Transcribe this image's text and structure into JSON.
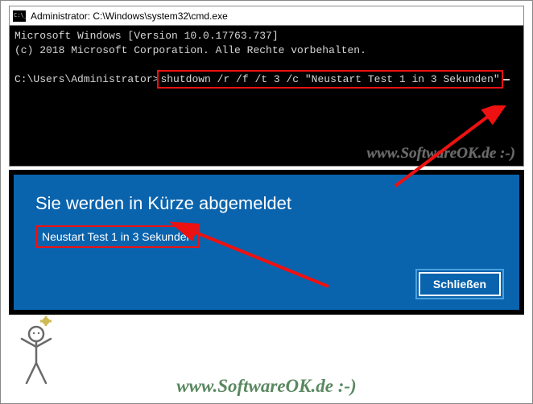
{
  "cmd": {
    "title": "Administrator: C:\\Windows\\system32\\cmd.exe",
    "line1": "Microsoft Windows [Version 10.0.17763.737]",
    "line2": "(c) 2018 Microsoft Corporation. Alle Rechte vorbehalten.",
    "prompt": "C:\\Users\\Administrator>",
    "command": "shutdown /r /f /t 3 /c \"Neustart Test 1 in 3 Sekunden\"",
    "watermark": "www.SoftwareOK.de :-)"
  },
  "dialog": {
    "title": "Sie werden in Kürze abgemeldet",
    "message": "Neustart Test 1 in 3 Sekunden",
    "close_label": "Schließen"
  },
  "footer": {
    "watermark": "www.SoftwareOK.de :-)"
  }
}
